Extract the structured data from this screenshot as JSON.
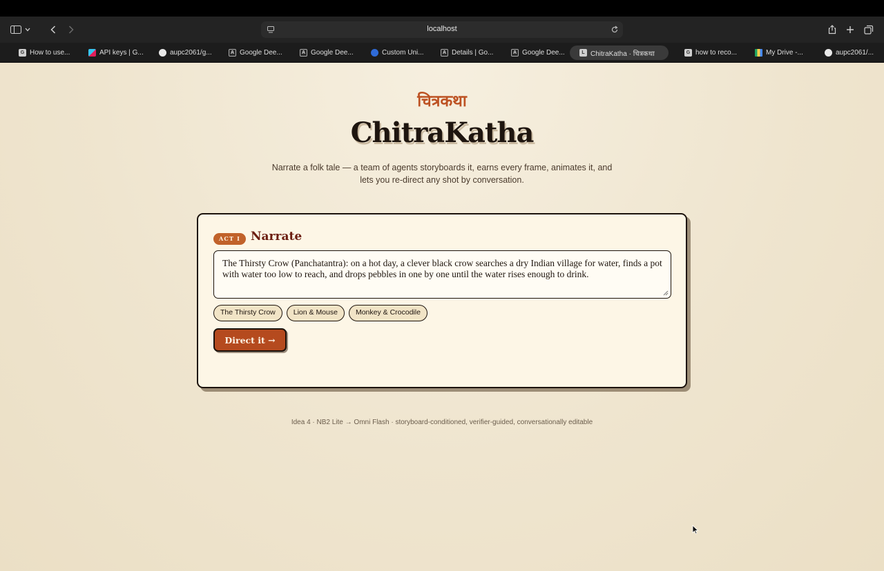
{
  "browser": {
    "address": "localhost",
    "tabs": [
      {
        "label": "How to use...",
        "icon": "google-docs-icon"
      },
      {
        "label": "API keys | G...",
        "icon": "slack-icon"
      },
      {
        "label": "aupc2061/g...",
        "icon": "github-icon"
      },
      {
        "label": "Google Dee...",
        "icon": "deepmind-icon"
      },
      {
        "label": "Google Dee...",
        "icon": "deepmind-icon"
      },
      {
        "label": "Custom Uni...",
        "icon": "custom-icon"
      },
      {
        "label": "Details | Go...",
        "icon": "deepmind-icon"
      },
      {
        "label": "Google Dee...",
        "icon": "deepmind-icon"
      },
      {
        "label": "ChitraKatha · चित्रकथा",
        "icon": "local-icon",
        "active": true
      },
      {
        "label": "how to reco...",
        "icon": "google-icon"
      },
      {
        "label": "My Drive -...",
        "icon": "drive-icon"
      },
      {
        "label": "aupc2061/...",
        "icon": "github-icon"
      }
    ]
  },
  "hero": {
    "devanagari": "चित्रकथा",
    "title": "ChitraKatha",
    "tagline": "Narrate a folk tale — a team of agents storyboards it, earns every frame, animates it, and lets you re-direct any shot by conversation."
  },
  "card": {
    "badge": "ACT I",
    "title": "Narrate",
    "story_value": "The Thirsty Crow (Panchatantra): on a hot day, a clever black crow searches a dry Indian village for water, finds a pot with water too low to reach, and drops pebbles in one by one until the water rises enough to drink.",
    "chips": [
      "The Thirsty Crow",
      "Lion & Mouse",
      "Monkey & Crocodile"
    ],
    "button_label": "Direct it →"
  },
  "footer": "Idea 4 · NB2 Lite → Omni Flash · storyboard-conditioned, verifier-guided, conversationally editable",
  "colors": {
    "accent": "#b54a1e",
    "title_red": "#6b1d10",
    "paper": "#efe5cf"
  }
}
